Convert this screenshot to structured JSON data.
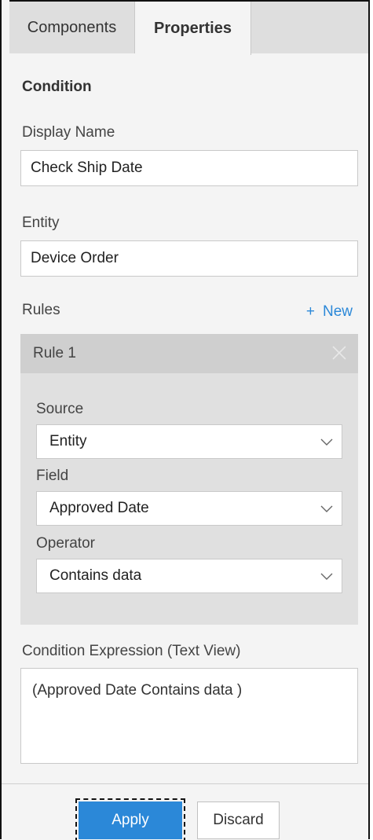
{
  "tabs": [
    {
      "label": "Components",
      "active": false
    },
    {
      "label": "Properties",
      "active": true
    }
  ],
  "section_title": "Condition",
  "display_name": {
    "label": "Display Name",
    "value": "Check Ship Date"
  },
  "entity": {
    "label": "Entity",
    "value": "Device Order"
  },
  "rules": {
    "label": "Rules",
    "new_label": "New",
    "items": [
      {
        "title": "Rule 1",
        "source": {
          "label": "Source",
          "value": "Entity"
        },
        "field": {
          "label": "Field",
          "value": "Approved Date"
        },
        "operator": {
          "label": "Operator",
          "value": "Contains data"
        }
      }
    ]
  },
  "expression": {
    "label": "Condition Expression (Text View)",
    "value": "(Approved Date Contains data )"
  },
  "buttons": {
    "apply": "Apply",
    "discard": "Discard"
  },
  "colors": {
    "accent": "#2b88d8",
    "panel_bg": "#f4f4f4",
    "rule_bg": "#e0e0e0",
    "rule_header_bg": "#cfcfcf"
  }
}
